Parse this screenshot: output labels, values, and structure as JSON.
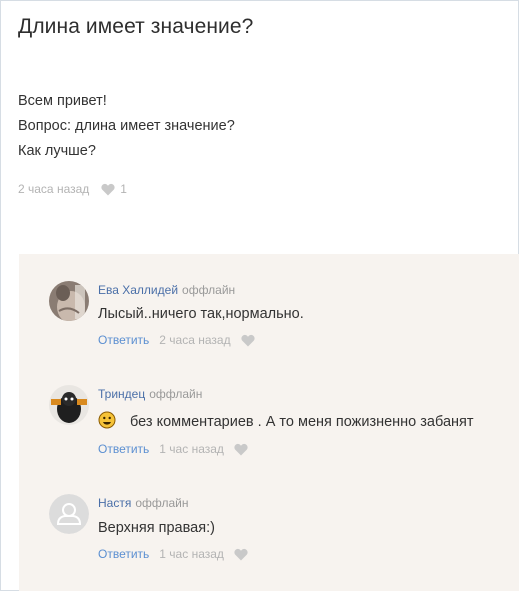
{
  "post": {
    "title": "Длина имеет значение?",
    "lines": [
      "Всем привет!",
      "Вопрос: длина имеет значение?",
      "Как лучше?"
    ],
    "time": "2 часа назад",
    "likes": "1"
  },
  "comments": [
    {
      "author": "Ева Халлидей",
      "status": "оффлайн",
      "text": "Лысый..ничего так,нормально.",
      "reply": "Ответить",
      "time": "2 часа назад"
    },
    {
      "author": "Триндец",
      "status": "оффлайн",
      "text": "без комментариев . А то меня пожизненно забанят",
      "reply": "Ответить",
      "time": "1 час назад"
    },
    {
      "author": "Настя",
      "status": "оффлайн",
      "text": "Верхняя правая:)",
      "reply": "Ответить",
      "time": "1 час назад"
    }
  ],
  "colors": {
    "link": "#4a6fa8",
    "reply": "#5b8fd1",
    "muted": "#b3b3b3",
    "comments_bg": "#f7f3ef"
  },
  "icons": [
    "heart-icon",
    "smiley-icon",
    "default-avatar-icon"
  ]
}
